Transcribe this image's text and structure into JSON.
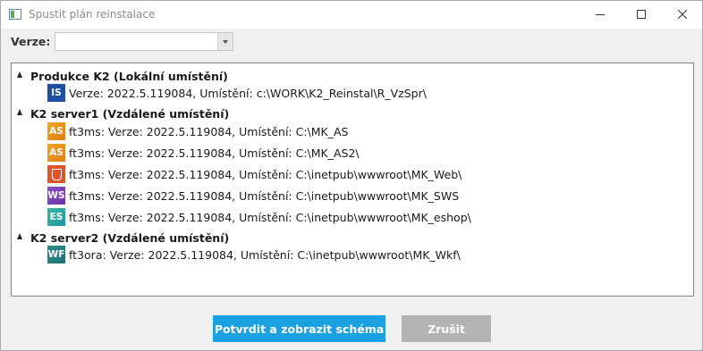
{
  "window": {
    "title": "Spustit plán reinstalace"
  },
  "form": {
    "version_label": "Verze:",
    "version_value": ""
  },
  "tree": {
    "groups": [
      {
        "label": "Produkce K2 (Lokální umístění)",
        "items": [
          {
            "icon": "IS",
            "icon_name": "is-app-icon",
            "text": "Verze: 2022.5.119084, Umístění: c:\\WORK\\K2_Reinstal\\R_VzSpr\\"
          }
        ]
      },
      {
        "label": "K2 server1 (Vzdálené umístění)",
        "items": [
          {
            "icon": "AS",
            "icon_name": "as-app-icon",
            "text": "ft3ms:  Verze: 2022.5.119084, Umístění: C:\\MK_AS"
          },
          {
            "icon": "AS",
            "icon_name": "as-app-icon",
            "text": "ft3ms:  Verze: 2022.5.119084, Umístění: C:\\MK_AS2\\"
          },
          {
            "icon": "",
            "icon_name": "html5-icon",
            "text": "ft3ms:  Verze: 2022.5.119084, Umístění: C:\\inetpub\\wwwroot\\MK_Web\\"
          },
          {
            "icon": "WS",
            "icon_name": "ws-app-icon",
            "text": "ft3ms:  Verze: 2022.5.119084, Umístění: C:\\inetpub\\wwwroot\\MK_SWS"
          },
          {
            "icon": "ES",
            "icon_name": "es-app-icon",
            "text": "ft3ms:  Verze: 2022.5.119084, Umístění: C:\\inetpub\\wwwroot\\MK_eshop\\"
          }
        ]
      },
      {
        "label": "K2 server2 (Vzdálené umístění)",
        "items": [
          {
            "icon": "WF",
            "icon_name": "wf-app-icon",
            "text": "ft3ora:  Verze: 2022.5.119084, Umístění: C:\\inetpub\\wwwroot\\MK_Wkf\\"
          }
        ]
      }
    ]
  },
  "buttons": {
    "confirm": "Potvrdit a zobrazit schéma",
    "cancel": "Zrušit"
  },
  "colors": {
    "accent": "#1ba1e2",
    "disabled": "#b3b3b3"
  }
}
